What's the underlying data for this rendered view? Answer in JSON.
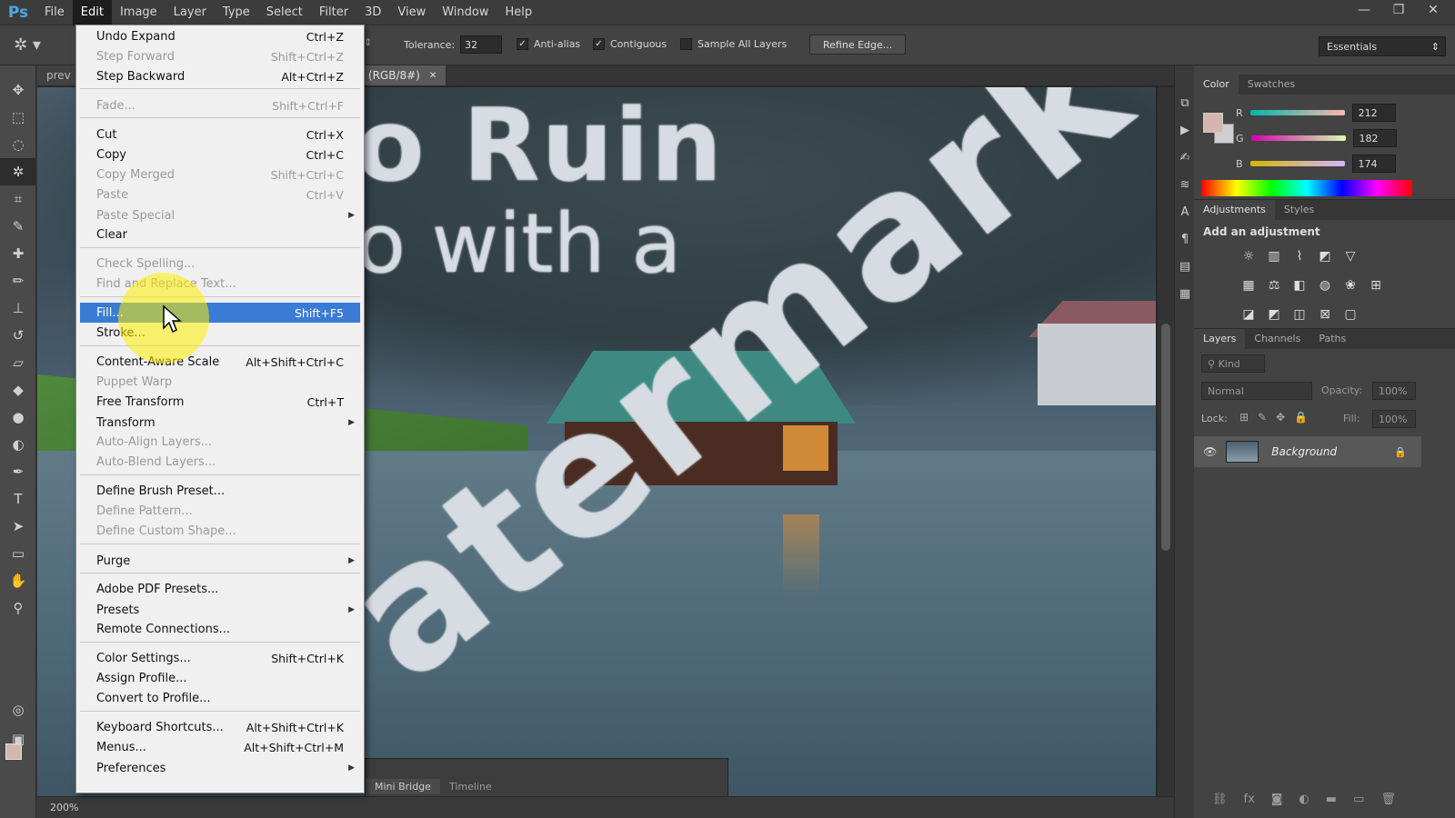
{
  "app": {
    "logo": "Ps",
    "menus": [
      "File",
      "Edit",
      "Image",
      "Layer",
      "Type",
      "Select",
      "Filter",
      "3D",
      "View",
      "Window",
      "Help"
    ],
    "window_controls": [
      "—",
      "❐",
      "✕"
    ]
  },
  "options_bar": {
    "tolerance_label": "Tolerance:",
    "tolerance_value": "32",
    "anti_alias_label": "Anti-alias",
    "contiguous_label": "Contiguous",
    "sample_all_layers_label": "Sample All Layers",
    "refine_edge_label": "Refine Edge...",
    "workspace": "Essentials"
  },
  "document": {
    "tabs": [
      "prev",
      "200% (RGB/8#)"
    ],
    "watermark_lines": [
      "o Ruin",
      "o with a",
      "atermark"
    ],
    "zoom": "200%",
    "mini_tabs": [
      "Mini Bridge",
      "Timeline"
    ]
  },
  "edit_menu": {
    "items": [
      {
        "label": "Undo Expand",
        "shortcut": "Ctrl+Z",
        "disabled": false
      },
      {
        "label": "Step Forward",
        "shortcut": "Shift+Ctrl+Z",
        "disabled": true
      },
      {
        "label": "Step Backward",
        "shortcut": "Alt+Ctrl+Z",
        "disabled": false
      },
      {
        "label": "Fade...",
        "shortcut": "Shift+Ctrl+F",
        "disabled": true
      },
      {
        "label": "Cut",
        "shortcut": "Ctrl+X",
        "disabled": false
      },
      {
        "label": "Copy",
        "shortcut": "Ctrl+C",
        "disabled": false
      },
      {
        "label": "Copy Merged",
        "shortcut": "Shift+Ctrl+C",
        "disabled": true
      },
      {
        "label": "Paste",
        "shortcut": "Ctrl+V",
        "disabled": true
      },
      {
        "label": "Paste Special",
        "shortcut": "",
        "disabled": true
      },
      {
        "label": "Clear",
        "shortcut": "",
        "disabled": false
      },
      {
        "label": "Check Spelling...",
        "shortcut": "",
        "disabled": true
      },
      {
        "label": "Find and Replace Text...",
        "shortcut": "",
        "disabled": true
      },
      {
        "label": "Fill...",
        "shortcut": "Shift+F5",
        "disabled": false
      },
      {
        "label": "Stroke...",
        "shortcut": "",
        "disabled": false
      },
      {
        "label": "Content-Aware Scale",
        "shortcut": "Alt+Shift+Ctrl+C",
        "disabled": false
      },
      {
        "label": "Puppet Warp",
        "shortcut": "",
        "disabled": true
      },
      {
        "label": "Free Transform",
        "shortcut": "Ctrl+T",
        "disabled": false
      },
      {
        "label": "Transform",
        "shortcut": "",
        "disabled": false
      },
      {
        "label": "Auto-Align Layers...",
        "shortcut": "",
        "disabled": true
      },
      {
        "label": "Auto-Blend Layers...",
        "shortcut": "",
        "disabled": true
      },
      {
        "label": "Define Brush Preset...",
        "shortcut": "",
        "disabled": false
      },
      {
        "label": "Define Pattern...",
        "shortcut": "",
        "disabled": true
      },
      {
        "label": "Define Custom Shape...",
        "shortcut": "",
        "disabled": true
      },
      {
        "label": "Purge",
        "shortcut": "",
        "disabled": false
      },
      {
        "label": "Adobe PDF Presets...",
        "shortcut": "",
        "disabled": false
      },
      {
        "label": "Presets",
        "shortcut": "",
        "disabled": false
      },
      {
        "label": "Remote Connections...",
        "shortcut": "",
        "disabled": false
      },
      {
        "label": "Color Settings...",
        "shortcut": "Shift+Ctrl+K",
        "disabled": false
      },
      {
        "label": "Assign Profile...",
        "shortcut": "",
        "disabled": false
      },
      {
        "label": "Convert to Profile...",
        "shortcut": "",
        "disabled": false
      },
      {
        "label": "Keyboard Shortcuts...",
        "shortcut": "Alt+Shift+Ctrl+K",
        "disabled": false
      },
      {
        "label": "Menus...",
        "shortcut": "Alt+Shift+Ctrl+M",
        "disabled": false
      },
      {
        "label": "Preferences",
        "shortcut": "",
        "disabled": false
      }
    ],
    "highlighted": "Fill..."
  },
  "color_panel": {
    "tabs": [
      "Color",
      "Swatches"
    ],
    "r_label": "R",
    "r_value": "212",
    "g_label": "G",
    "g_value": "182",
    "b_label": "B",
    "b_value": "174",
    "foreground": "#d4b6ae"
  },
  "adjustments_panel": {
    "tabs": [
      "Adjustments",
      "Styles"
    ],
    "title": "Add an adjustment"
  },
  "layers_panel": {
    "tabs": [
      "Layers",
      "Channels",
      "Paths"
    ],
    "kind_label": "Kind",
    "blend_mode": "Normal",
    "opacity_label": "Opacity:",
    "opacity_value": "100%",
    "lock_label": "Lock:",
    "fill_label": "Fill:",
    "fill_value": "100%",
    "layer_name": "Background"
  },
  "colors": {
    "highlight": "#3a7bd5",
    "ps_blue": "#4aa8e8"
  }
}
